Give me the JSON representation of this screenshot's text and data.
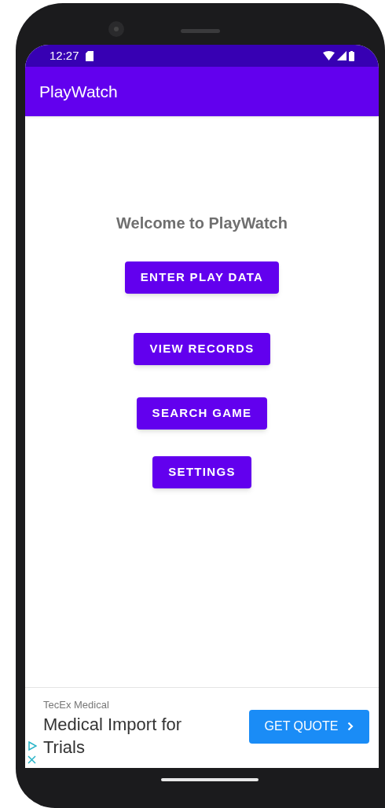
{
  "status_bar": {
    "time": "12:27"
  },
  "app_bar": {
    "title": "PlayWatch"
  },
  "welcome": "Welcome to PlayWatch",
  "buttons": [
    {
      "label": "ENTER PLAY DATA"
    },
    {
      "label": "VIEW RECORDS"
    },
    {
      "label": "SEARCH GAME"
    },
    {
      "label": "SETTINGS"
    }
  ],
  "ad": {
    "advertiser": "TecEx Medical",
    "headline": "Medical Import for Trials",
    "cta": "GET QUOTE"
  }
}
